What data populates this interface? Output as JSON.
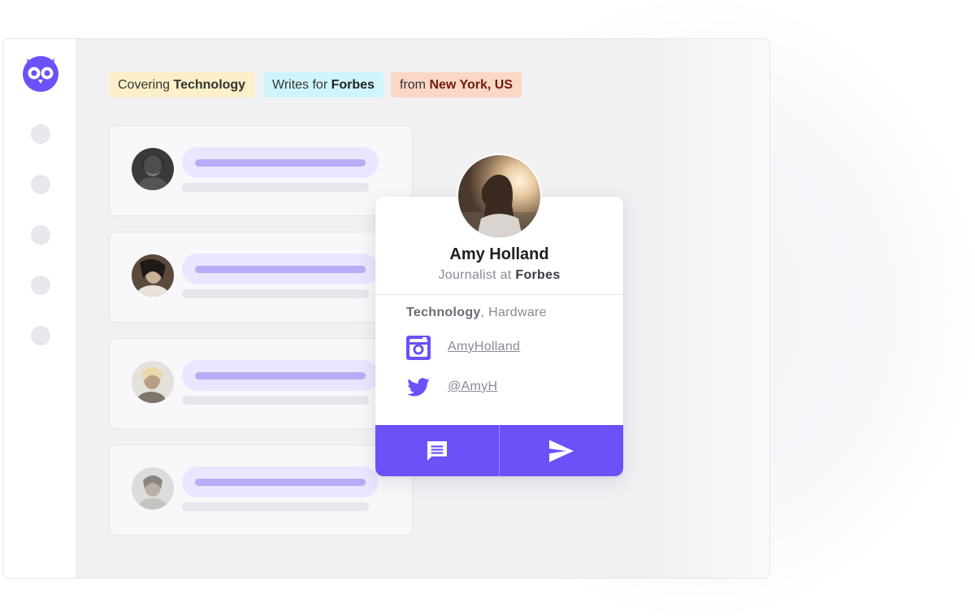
{
  "filters": {
    "topic": {
      "prefix": "Covering",
      "value": "Technology"
    },
    "publication": {
      "prefix": "Writes for",
      "value": "Forbes"
    },
    "location": {
      "prefix": "from",
      "value": "New York, US"
    }
  },
  "colors": {
    "brand": "#6a51f8",
    "chip_topic_bg": "#fdf0c8",
    "chip_publication_bg": "#cff5fb",
    "chip_location_bg": "#fbd7c5"
  },
  "sidebar": {
    "logo_icon": "owl-logo-icon",
    "nav_count": 5
  },
  "journalist_list": {
    "rows": [
      {
        "avatar": "journalist-avatar"
      },
      {
        "avatar": "journalist-avatar"
      },
      {
        "avatar": "journalist-avatar"
      },
      {
        "avatar": "journalist-avatar"
      }
    ]
  },
  "profile": {
    "name": "Amy Holland",
    "role_prefix": "Journalist at",
    "outlet": "Forbes",
    "primary_topic": "Technology",
    "topics_rest": ", Hardware",
    "instagram": {
      "icon": "instagram-icon",
      "handle": "AmyHolland"
    },
    "twitter": {
      "icon": "twitter-icon",
      "handle": "@AmyH"
    },
    "actions": [
      {
        "icon": "message-icon"
      },
      {
        "icon": "send-icon"
      }
    ]
  }
}
